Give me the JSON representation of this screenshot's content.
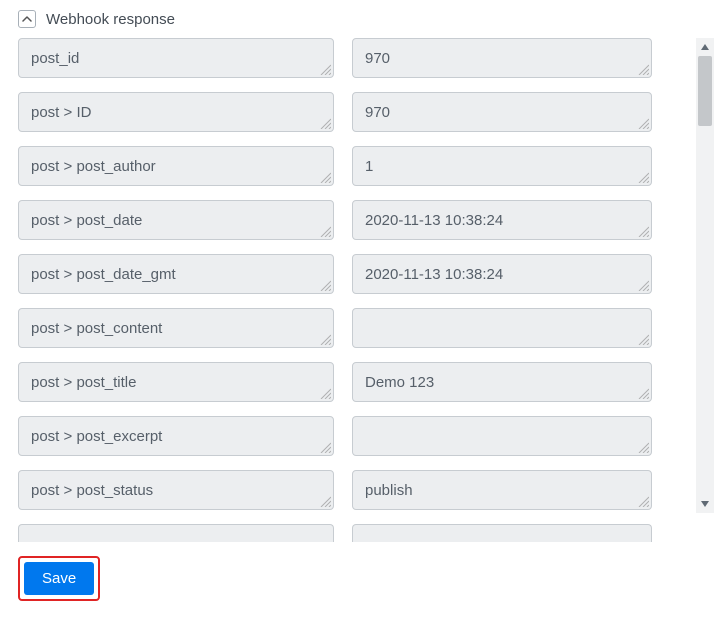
{
  "section": {
    "title": "Webhook response"
  },
  "rows": [
    {
      "key": "post_id",
      "value": "970"
    },
    {
      "key": "post > ID",
      "value": "970"
    },
    {
      "key": "post > post_author",
      "value": "1"
    },
    {
      "key": "post > post_date",
      "value": "2020-11-13 10:38:24"
    },
    {
      "key": "post > post_date_gmt",
      "value": "2020-11-13 10:38:24"
    },
    {
      "key": "post > post_content",
      "value": ""
    },
    {
      "key": "post > post_title",
      "value": "Demo 123"
    },
    {
      "key": "post > post_excerpt",
      "value": ""
    },
    {
      "key": "post > post_status",
      "value": "publish"
    }
  ],
  "footer": {
    "save_label": "Save"
  }
}
